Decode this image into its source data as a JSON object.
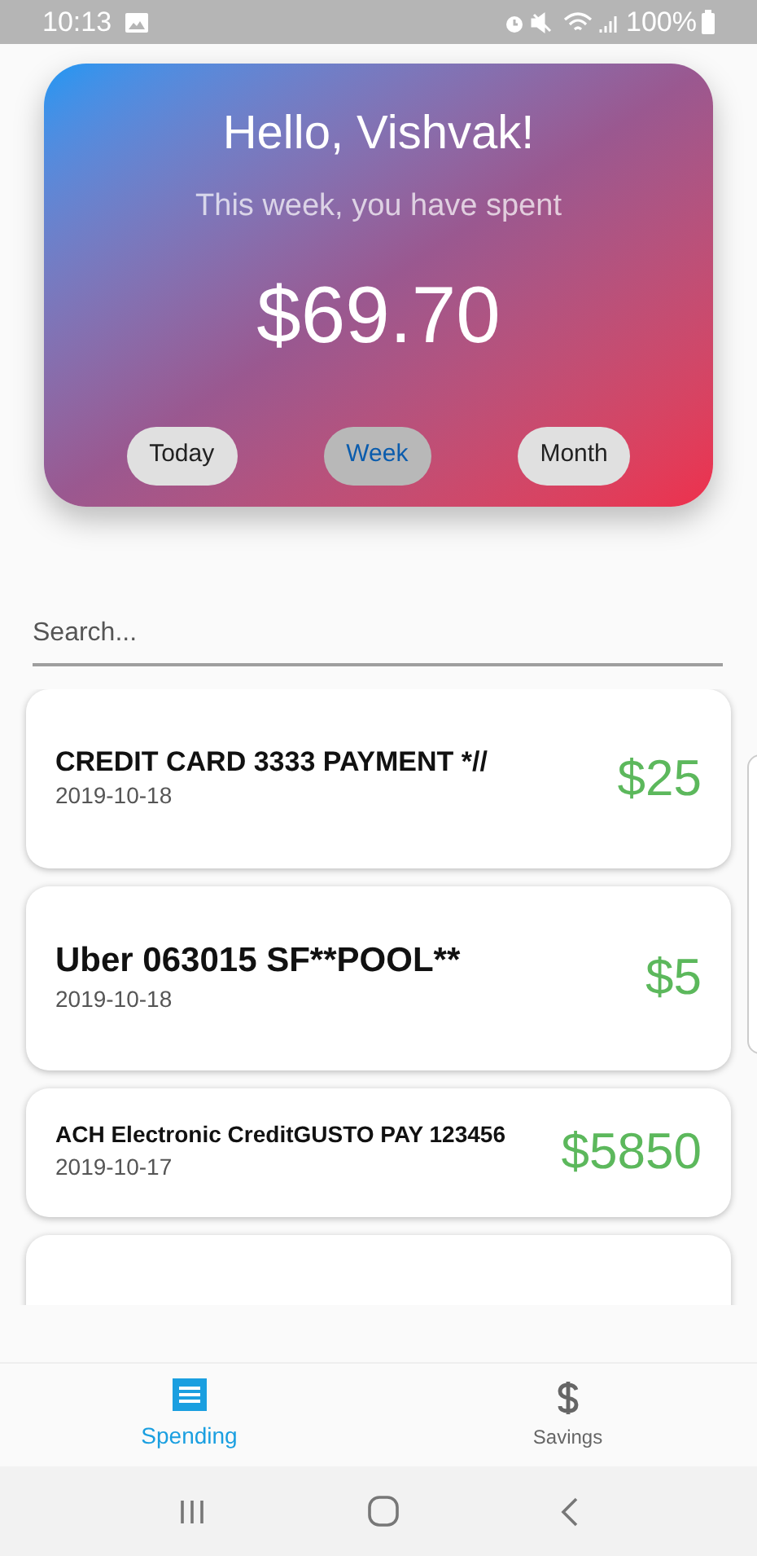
{
  "status_bar": {
    "time": "10:13",
    "battery": "100%"
  },
  "summary": {
    "greeting": "Hello, Vishvak!",
    "subtitle": "This week, you have spent",
    "amount": "$69.70",
    "periods": [
      {
        "label": "Today",
        "selected": false
      },
      {
        "label": "Week",
        "selected": true
      },
      {
        "label": "Month",
        "selected": false
      }
    ]
  },
  "search": {
    "placeholder": "Search..."
  },
  "transactions": [
    {
      "name": "CREDIT CARD 3333 PAYMENT *//",
      "date": "2019-10-18",
      "amount": "$25",
      "kind": "medium"
    },
    {
      "name": "Uber 063015 SF**POOL**",
      "date": "2019-10-18",
      "amount": "$5",
      "kind": "large"
    },
    {
      "name": "ACH Electronic CreditGUSTO PAY 123456",
      "date": "2019-10-17",
      "amount": "$5850",
      "kind": "small"
    }
  ],
  "tabs": [
    {
      "label": "Spending",
      "kind": "receipt",
      "selected": true
    },
    {
      "label": "Savings",
      "kind": "dollar",
      "selected": false
    }
  ]
}
